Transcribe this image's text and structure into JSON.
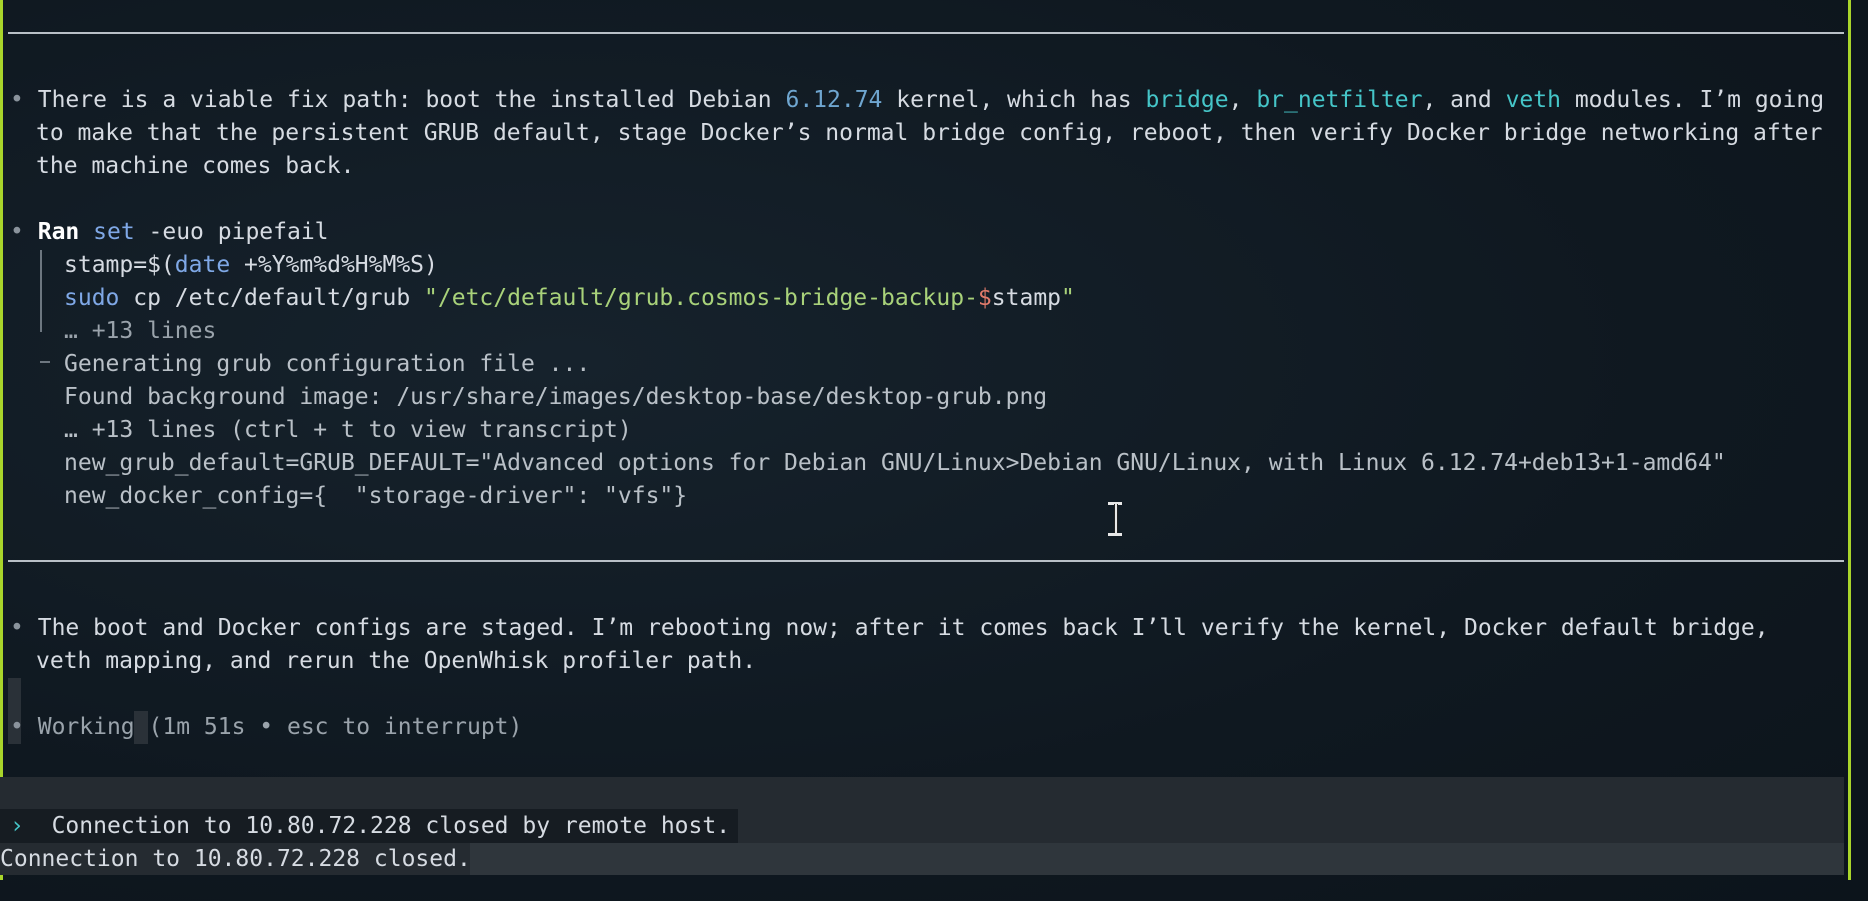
{
  "colors": {
    "background": "#101820",
    "accent_edge": "#a9d52b",
    "number": "#6fa6d0",
    "module": "#45c5c8",
    "keyword": "#7fa8e6",
    "string": "#a9d27a"
  },
  "messages": {
    "fix_path": {
      "bullet": "•",
      "line1_a": "There is a viable fix path: boot the installed Debian ",
      "line1_version": "6.12.74",
      "line1_b": " kernel, which has ",
      "mod_bridge": "bridge",
      "comma1": ", ",
      "mod_br_netfilter": "br_netfilter",
      "and": ", and ",
      "mod_veth": "veth",
      "line1_c": " modules. I’m going",
      "line2": "to make that the persistent GRUB default, stage Docker’s normal bridge config, reboot, then verify Docker bridge networking after",
      "line3": "the machine comes back."
    },
    "ran": {
      "bullet": "•",
      "ran_label": "Ran",
      "set_kw": "set",
      "set_args": " -euo pipefail",
      "stamp_a": "stamp=$(",
      "date_kw": "date",
      "stamp_b": " +%Y%m%d%H%M%S)",
      "sudo_kw": "sudo",
      "cp_cmd": " cp /etc/default/grub ",
      "cp_str": "\"/etc/default/grub.cosmos-bridge-backup-",
      "cp_dollar": "$",
      "cp_var": "stamp",
      "cp_end": "\"",
      "more_lines": "… +13 lines",
      "out1": "Generating grub configuration file ...",
      "out2": "Found background image: /usr/share/images/desktop-base/desktop-grub.png",
      "out3": "… +13 lines (ctrl + t to view transcript)",
      "out4": "new_grub_default=GRUB_DEFAULT=\"Advanced options for Debian GNU/Linux>Debian GNU/Linux, with Linux 6.12.74+deb13+1-amd64\"",
      "out5": "new_docker_config={  \"storage-driver\": \"vfs\"}"
    },
    "staged": {
      "bullet": "•",
      "line1": "The boot and Docker configs are staged. I’m rebooting now; after it comes back I’ll verify the kernel, Docker default bridge,",
      "line2": "veth mapping, and rerun the OpenWhisk profiler path."
    },
    "working": {
      "bullet": "•",
      "label": "Working",
      "status": " (1m 51s • esc to interrupt)"
    }
  },
  "terminal": {
    "prompt_symbol": "›",
    "closed_by_remote": "Connection to 10.80.72.228 closed by remote host.",
    "closed": "Connection to 10.80.72.228 closed."
  }
}
